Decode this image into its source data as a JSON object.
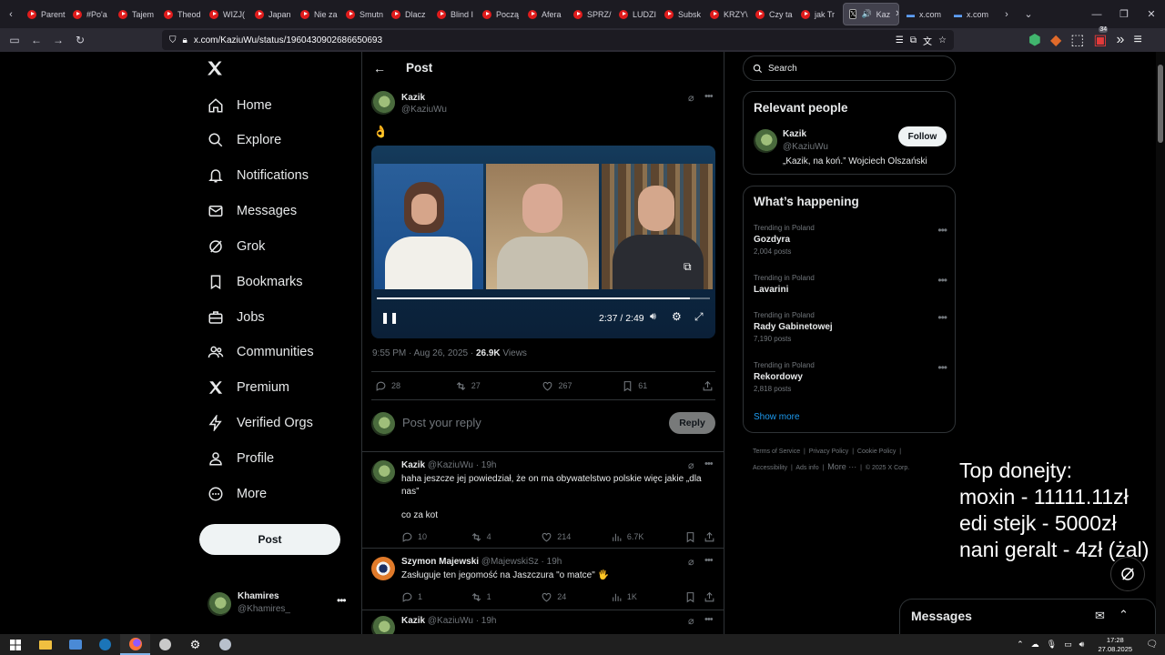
{
  "browser": {
    "tabs": [
      {
        "label": "Parent"
      },
      {
        "label": "#Po'a"
      },
      {
        "label": "Tajem"
      },
      {
        "label": "Theod"
      },
      {
        "label": "WIZJ("
      },
      {
        "label": "Japan"
      },
      {
        "label": "Nie za"
      },
      {
        "label": "Smutn"
      },
      {
        "label": "Dlacz"
      },
      {
        "label": "Blind I"
      },
      {
        "label": "Począ"
      },
      {
        "label": "Afera"
      },
      {
        "label": "SPRZ/"
      },
      {
        "label": "LUDZI"
      },
      {
        "label": "Subsk"
      },
      {
        "label": "KRZY\\"
      },
      {
        "label": "Czy ta"
      },
      {
        "label": "jak Tr"
      }
    ],
    "active_tab": {
      "label": "Kaz"
    },
    "extra_tabs": [
      {
        "label": "x.com"
      },
      {
        "label": "x.com"
      }
    ],
    "url": "x.com/KaziuWu/status/1960430902686650693",
    "badge_count": "34"
  },
  "nav": {
    "items": [
      {
        "label": "Home"
      },
      {
        "label": "Explore"
      },
      {
        "label": "Notifications"
      },
      {
        "label": "Messages"
      },
      {
        "label": "Grok"
      },
      {
        "label": "Bookmarks"
      },
      {
        "label": "Jobs"
      },
      {
        "label": "Communities"
      },
      {
        "label": "Premium"
      },
      {
        "label": "Verified Orgs"
      },
      {
        "label": "Profile"
      },
      {
        "label": "More"
      }
    ],
    "post_button": "Post",
    "account": {
      "name": "Khamires",
      "handle": "@Khamires_"
    }
  },
  "post": {
    "header_title": "Post",
    "author_name": "Kazik",
    "author_handle": "@KaziuWu",
    "text": "👌",
    "video": {
      "time": "2:37 / 2:49",
      "progress": 0.94
    },
    "meta_time": "9:55 PM · Aug 26, 2025 · ",
    "views_count": "26.9K",
    "views_label": " Views",
    "stats": {
      "replies": "28",
      "reposts": "27",
      "likes": "267",
      "bookmarks": "61"
    },
    "reply_placeholder": "Post your reply",
    "reply_button": "Reply"
  },
  "replies": [
    {
      "name": "Kazik",
      "handle": "@KaziuWu",
      "time": "· 19h",
      "text": "haha jeszcze jej powiedział, że on ma obywatelstwo polskie więc jakie „dla nas”",
      "text2": "co za kot",
      "replies": "10",
      "reposts": "4",
      "likes": "214",
      "views": "6.7K"
    },
    {
      "name": "Szymon Majewski",
      "handle": "@MajewskiSz",
      "time": "· 19h",
      "text": "Zasługuje ten jegomość na Jaszczura \"o matce\" 🖐",
      "replies": "1",
      "reposts": "1",
      "likes": "24",
      "views": "1K"
    },
    {
      "name": "Kazik",
      "handle": "@KaziuWu",
      "time": "· 19h"
    }
  ],
  "sidebar": {
    "search_placeholder": "Search",
    "relevant_title": "Relevant people",
    "person": {
      "name": "Kazik",
      "handle": "@KaziuWu",
      "bio": "„Kazik, na koń.” Wojciech Olszański",
      "follow": "Follow"
    },
    "happening_title": "What’s happening",
    "trends": [
      {
        "context": "Trending in Poland",
        "name": "Gozdyra",
        "posts": "2,004 posts"
      },
      {
        "context": "Trending in Poland",
        "name": "Lavarini",
        "posts": ""
      },
      {
        "context": "Trending in Poland",
        "name": "Rady Gabinetowej",
        "posts": "7,190 posts"
      },
      {
        "context": "Trending in Poland",
        "name": "Rekordowy",
        "posts": "2,818 posts"
      }
    ],
    "show_more": "Show more",
    "footer": [
      "Terms of Service",
      "Privacy Policy",
      "Cookie Policy",
      "Accessibility",
      "Ads info",
      "More ···",
      "© 2025 X Corp."
    ]
  },
  "overlay": {
    "line1": "Top donejty:",
    "line2": "moxin - 11111.11zł",
    "line3": "edi stejk - 5000zł",
    "line4": "nani geralt - 4zł (żal)"
  },
  "messages_drawer": {
    "title": "Messages"
  },
  "taskbar": {
    "time": "17:28",
    "date": "27.08.2025"
  },
  "colors": {
    "bg": "#000000",
    "text": "#e7e9ea",
    "muted": "#71767b",
    "border": "#2f3336",
    "accent": "#1d9bf0",
    "tab_red": "#e01c1c"
  }
}
